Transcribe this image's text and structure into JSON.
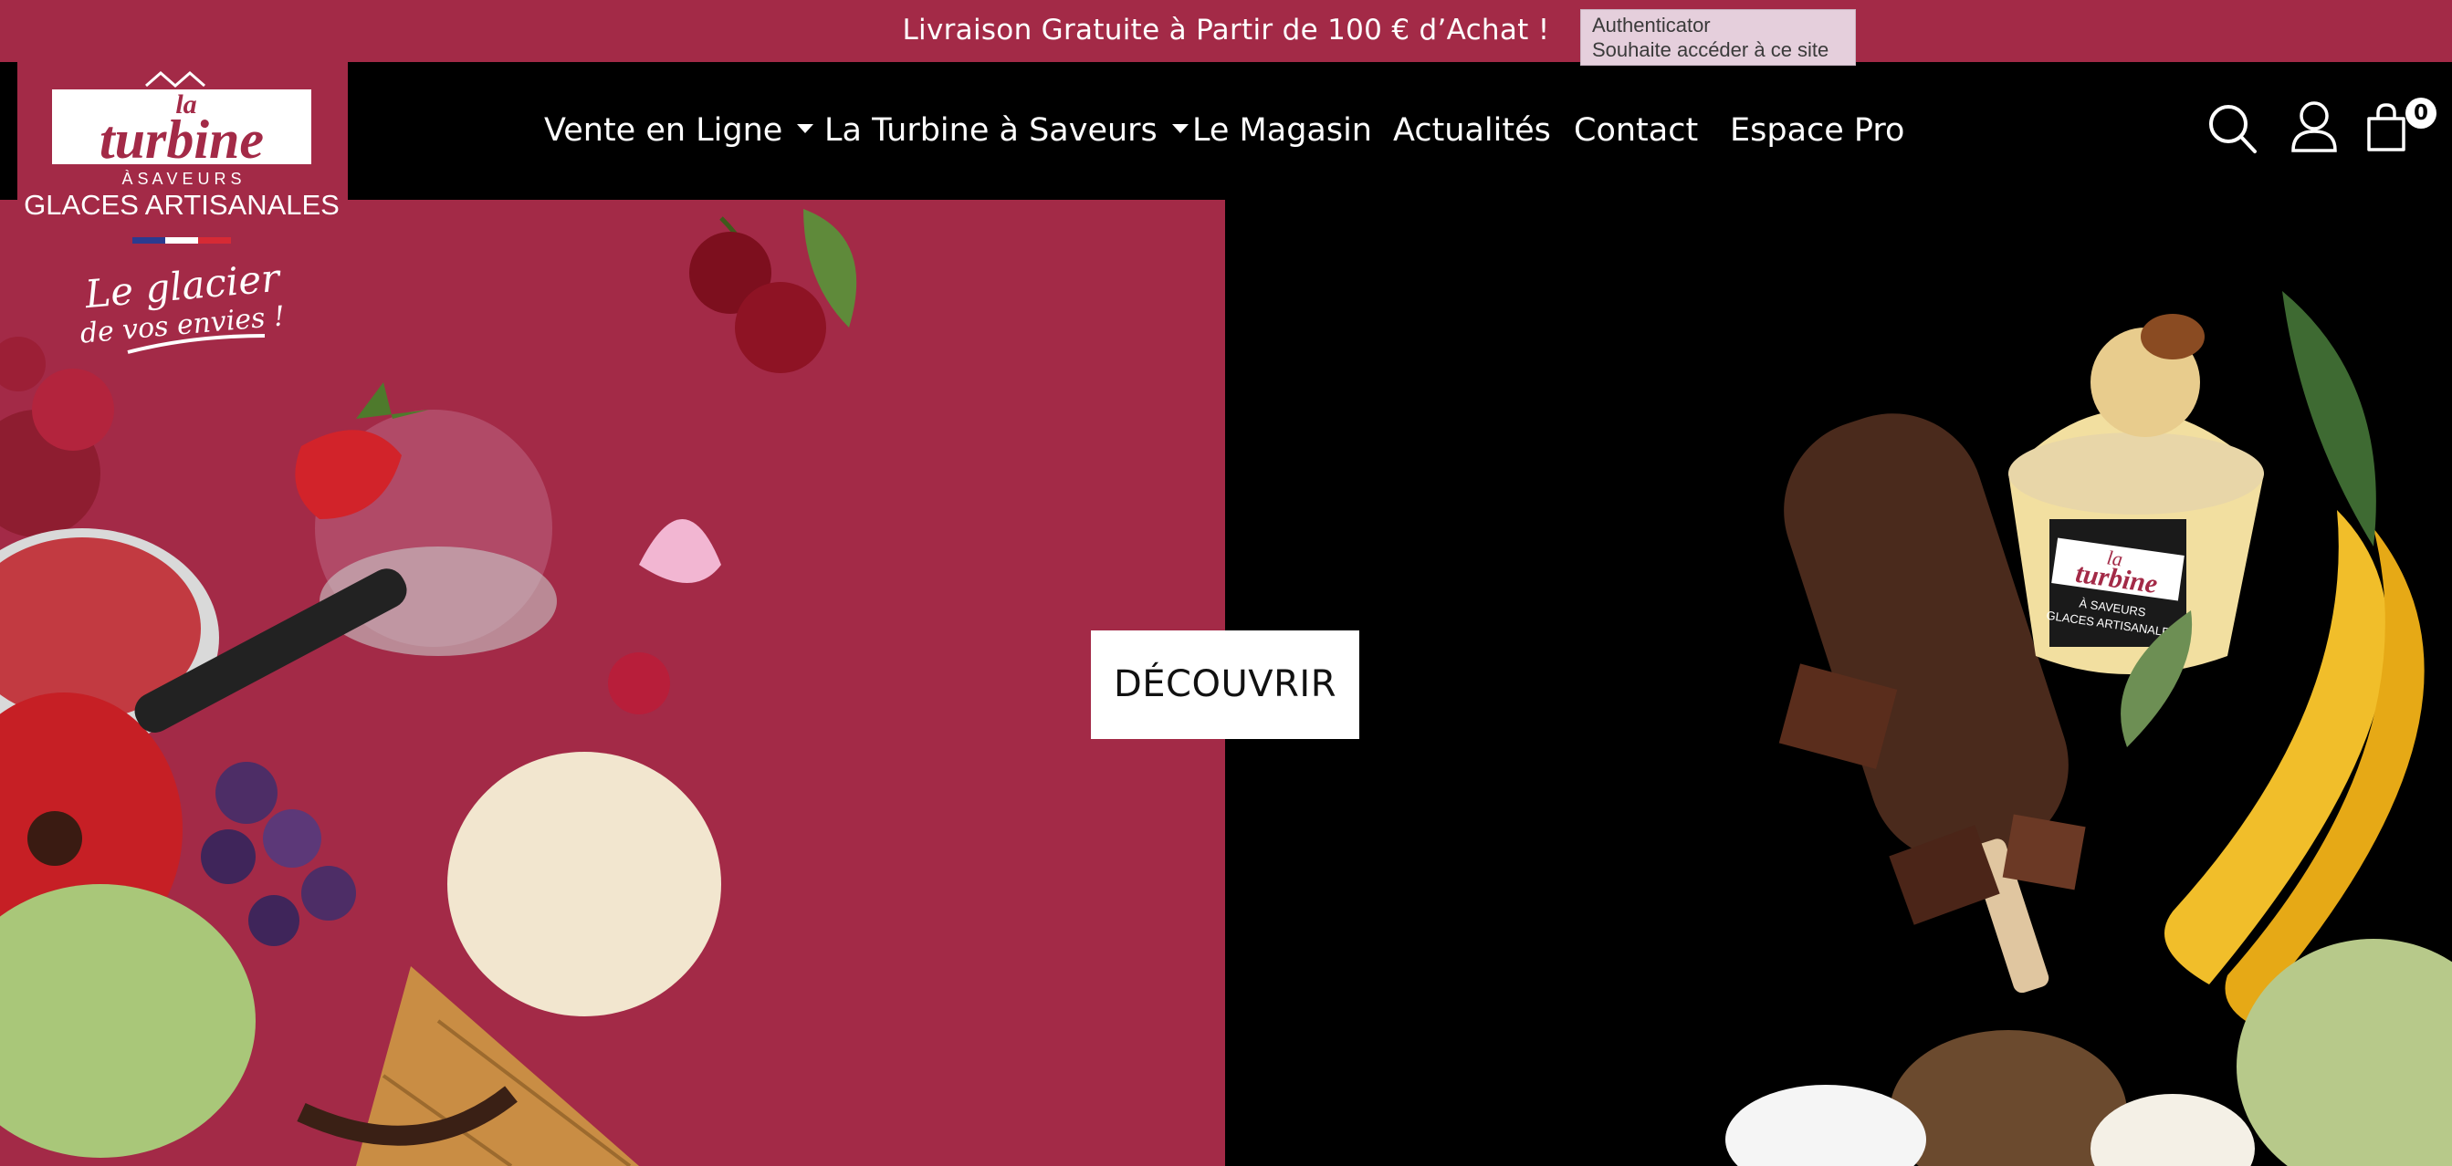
{
  "announcement": "Livraison Gratuite à Partir de 100 € d’Achat !",
  "tooltip": {
    "title": "Authenticator",
    "text": "Souhaite accéder à ce site"
  },
  "logo": {
    "line1": "la",
    "line2": "turbine",
    "line3": "À  S A V E U R S",
    "line4": "GLACES ARTISANALES",
    "tagline1": "Le glacier",
    "tagline2": "de vos envies !"
  },
  "nav": [
    {
      "label": "Vente en Ligne",
      "dropdown": true
    },
    {
      "label": "La Turbine à Saveurs",
      "dropdown": true
    },
    {
      "label": "Le Magasin",
      "dropdown": false
    },
    {
      "label": "Actualités",
      "dropdown": false
    },
    {
      "label": "Contact",
      "dropdown": false
    },
    {
      "label": "Espace Pro",
      "dropdown": false
    }
  ],
  "icons": {
    "search": "search-icon",
    "account": "user-icon",
    "cart": "shopping-bag-icon"
  },
  "cart_count": "0",
  "hero": {
    "cta_label": "DÉCOUVRIR",
    "pot_label1": "la",
    "pot_label2": "turbine",
    "pot_label3": "À SAVEURS",
    "pot_label4": "GLACES ARTISANALES"
  },
  "colors": {
    "brand": "#a32a47",
    "header": "#000000"
  }
}
